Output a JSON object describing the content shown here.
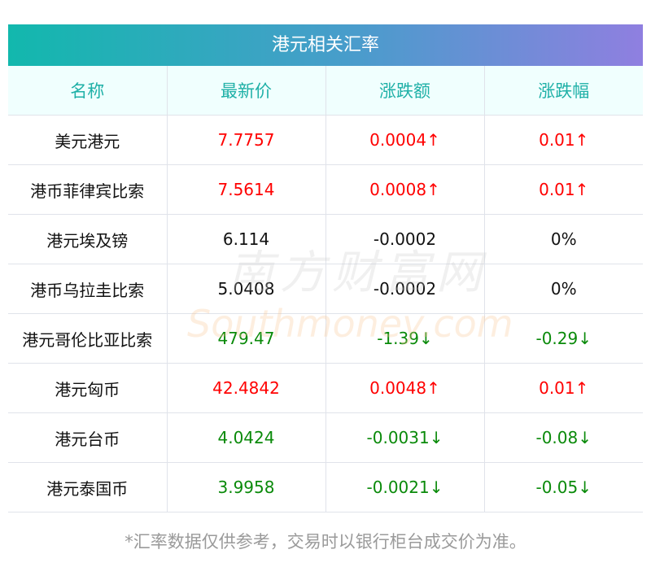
{
  "title": "港元相关汇率",
  "columns": [
    "名称",
    "最新价",
    "涨跌额",
    "涨跌幅"
  ],
  "rows": [
    {
      "name": "美元港元",
      "price": "7.7757",
      "change": "0.0004↑",
      "pct": "0.01↑",
      "trend": "up"
    },
    {
      "name": "港币菲律宾比索",
      "price": "7.5614",
      "change": "0.0008↑",
      "pct": "0.01↑",
      "trend": "up"
    },
    {
      "name": "港元埃及镑",
      "price": "6.114",
      "change": "-0.0002",
      "pct": "0%",
      "trend": "flat"
    },
    {
      "name": "港币乌拉圭比索",
      "price": "5.0408",
      "change": "-0.0002",
      "pct": "0%",
      "trend": "flat"
    },
    {
      "name": "港元哥伦比亚比索",
      "price": "479.47",
      "change": "-1.39↓",
      "pct": "-0.29↓",
      "trend": "down"
    },
    {
      "name": "港元匈币",
      "price": "42.4842",
      "change": "0.0048↑",
      "pct": "0.01↑",
      "trend": "up"
    },
    {
      "name": "港元台币",
      "price": "4.0424",
      "change": "-0.0031↓",
      "pct": "-0.08↓",
      "trend": "down"
    },
    {
      "name": "港元泰国币",
      "price": "3.9958",
      "change": "-0.0021↓",
      "pct": "-0.05↓",
      "trend": "down"
    }
  ],
  "footer": "*汇率数据仅供参考，交易时以银行柜台成交价为准。",
  "watermark": {
    "cn": "南方财富网",
    "en": "Southmoney.com"
  },
  "colors": {
    "up": "#ff0000",
    "down": "#0a8a0a",
    "header_text": "#1fb0a7"
  }
}
